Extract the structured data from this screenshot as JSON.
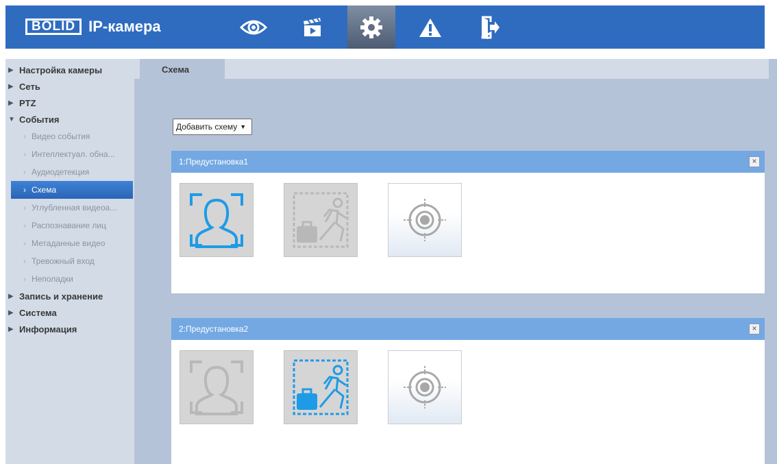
{
  "header": {
    "logo_box": "BOLID",
    "logo_text": "IP-камера",
    "nav": [
      {
        "icon": "eye-icon",
        "active": false
      },
      {
        "icon": "clapperboard-icon",
        "active": false
      },
      {
        "icon": "gear-icon",
        "active": true
      },
      {
        "icon": "warning-icon",
        "active": false
      },
      {
        "icon": "logout-icon",
        "active": false
      }
    ]
  },
  "sidebar": {
    "top_items": [
      {
        "label": "Настройка камеры",
        "expanded": false
      },
      {
        "label": "Сеть",
        "expanded": false
      },
      {
        "label": "PTZ",
        "expanded": false
      },
      {
        "label": "События",
        "expanded": true
      }
    ],
    "sub_items": [
      {
        "label": "Видео события",
        "active": false
      },
      {
        "label": "Интеллектуал. обна...",
        "active": false
      },
      {
        "label": "Аудиодетекция",
        "active": false
      },
      {
        "label": "Схема",
        "active": true
      },
      {
        "label": "Углубленная видеоа...",
        "active": false
      },
      {
        "label": "Распознавание лиц",
        "active": false
      },
      {
        "label": "Метаданные видео",
        "active": false
      },
      {
        "label": "Тревожный вход",
        "active": false
      },
      {
        "label": "Неполадки",
        "active": false
      }
    ],
    "bottom_items": [
      {
        "label": "Запись и хранение"
      },
      {
        "label": "Система"
      },
      {
        "label": "Информация"
      }
    ]
  },
  "main": {
    "tab": "Схема",
    "add_button": "Добавить схему",
    "presets": [
      {
        "title": "1:Предустановка1",
        "close": "×",
        "selected": "face"
      },
      {
        "title": "2:Предустановка2",
        "close": "×",
        "selected": "intrusion"
      }
    ]
  },
  "colors": {
    "header_bg": "#2f6cc0",
    "panel_head": "#73a8e3",
    "active_blue": "#1e9be6",
    "inactive_gray": "#b8b8b8"
  }
}
